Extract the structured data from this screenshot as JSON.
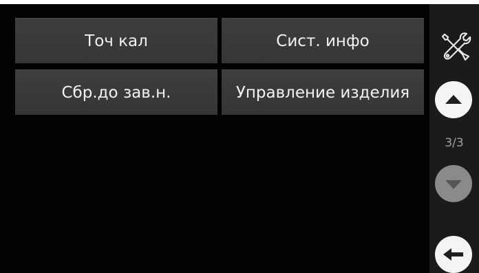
{
  "menu": {
    "buttons": [
      {
        "label": "Точ кал"
      },
      {
        "label": "Сист. инфо"
      },
      {
        "label": "Сбр.до зав.н."
      },
      {
        "label": "Управление изделия"
      }
    ]
  },
  "sidebar": {
    "settings_icon": "wrench-screwdriver-icon",
    "up_icon": "arrow-up-icon",
    "down_icon": "arrow-down-icon",
    "back_icon": "arrow-left-icon",
    "page_indicator": "3/3",
    "down_disabled": true
  },
  "colors": {
    "background": "#020202",
    "button": "#3a3a3a",
    "button_text": "#f2f2f2",
    "sidebar": "#1b1b1b",
    "active_circle": "#f4f4f4",
    "disabled_circle": "#8a8a8a"
  }
}
